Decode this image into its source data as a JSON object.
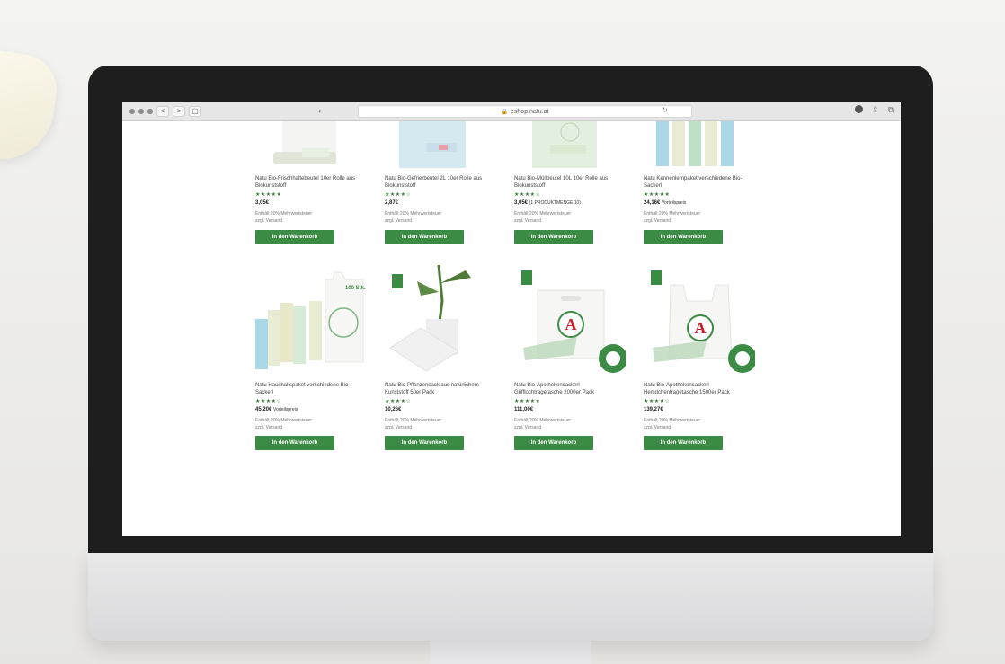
{
  "browser": {
    "url": "eshop.natu.at",
    "nav_back": "<",
    "nav_forward": ">",
    "sidebar_glyph": "▢",
    "shield_glyph": "◐",
    "reload_glyph": "↻",
    "share_glyph": "⇪",
    "tabs_glyph": "⧉"
  },
  "colors": {
    "cart_button": "#3c8b45",
    "star": "#3b7d3b"
  },
  "products_row1": [
    {
      "title": "Natu Bio-Frischhaltebeutel 10er Rolle aus Biokunststoff",
      "stars": "★★★★★",
      "price": "3,05€",
      "price_note": "",
      "tax": "Enthält 20% Mehrwertsteuer",
      "ship": "zzgl. Versand",
      "cart_label": "In den Warenkorb"
    },
    {
      "title": "Natu Bio-Gefrierbeutel 2L 10er Rolle aus Biokunststoff",
      "stars": "★★★★☆",
      "price": "2,87€",
      "price_note": "",
      "tax": "Enthält 20% Mehrwertsteuer",
      "ship": "zzgl. Versand",
      "cart_label": "In den Warenkorb"
    },
    {
      "title": "Natu Bio-Müllbeutel 10L 10er Rolle aus Biokunststoff",
      "stars": "★★★★☆",
      "price": "3,05€",
      "price_note": "(1 PRODUKTMENGE 10)",
      "tax": "Enthält 20% Mehrwertsteuer",
      "ship": "zzgl. Versand",
      "cart_label": "In den Warenkorb"
    },
    {
      "title": "Natu Kennenlernpaket verschiedene Bio-Sackerl",
      "stars": "★★★★★",
      "price": "24,16€",
      "price_note": "Vorteilspreis",
      "tax": "Enthält 20% Mehrwertsteuer",
      "ship": "zzgl. Versand",
      "cart_label": "In den Warenkorb"
    }
  ],
  "products_row2": [
    {
      "title": "Natu Haushaltspaket verschiedene Bio-Sackerl",
      "stars": "★★★★☆",
      "price": "45,20€",
      "price_note": "Vorteilspreis",
      "tax": "Enthält 20% Mehrwertsteuer",
      "ship": "zzgl. Versand",
      "cart_label": "In den Warenkorb",
      "badge": "100 Stk."
    },
    {
      "title": "Natu Bio-Pflanzensack aus natürlichem Kunststoff 50er Pack",
      "stars": "★★★★☆",
      "price": "10,26€",
      "price_note": "",
      "tax": "Enthält 20% Mehrwertsteuer",
      "ship": "zzgl. Versand",
      "cart_label": "In den Warenkorb"
    },
    {
      "title": "Natu Bio-Apothekensackerl Grifflochtragetasche 2000er Pack",
      "stars": "★★★★★",
      "price": "111,00€",
      "price_note": "",
      "tax": "Enthält 20% Mehrwertsteuer",
      "ship": "zzgl. Versand",
      "cart_label": "In den Warenkorb"
    },
    {
      "title": "Natu Bio-Apothekensackerl Hemdchentragetasche 1500er Pack",
      "stars": "★★★★☆",
      "price": "139,27€",
      "price_note": "",
      "tax": "Enthält 20% Mehrwertsteuer",
      "ship": "zzgl. Versand",
      "cart_label": "In den Warenkorb"
    }
  ]
}
